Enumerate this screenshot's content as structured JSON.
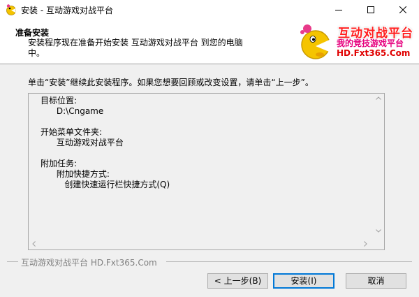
{
  "window": {
    "title": "安装 - 互动游戏对战平台",
    "controls": {
      "minimize_icon": "minimize-icon",
      "maximize_icon": "maximize-icon",
      "close_icon": "close-icon"
    }
  },
  "header": {
    "title": "准备安装",
    "description": "安装程序现在准备开始安装 互动游戏对战平台 到您的电脑中。",
    "logo": {
      "line1": "互动对战平台",
      "line2": "我的竞技游戏平台",
      "line3": "HD.Fxt365.Com"
    }
  },
  "main": {
    "instruction": "单击“安装”继续此安装程序。如果您想要回顾或改变设置，请单击“上一步”。",
    "summary": "目标位置:\n      D:\\Cngame\n\n开始菜单文件夹:\n      互动游戏对战平台\n\n附加任务:\n      附加快捷方式:\n         创建快速运行栏快捷方式(Q)"
  },
  "branding": {
    "text": "互动游戏对战平台  HD.Fxt365.Com"
  },
  "buttons": {
    "back": "< 上一步(B)",
    "install": "安装(I)",
    "cancel": "取消"
  },
  "colors": {
    "accent": "#0078d7",
    "logo_red": "#ff1e1e",
    "logo_pink": "#e6007e",
    "mascot_yellow": "#f5c400"
  }
}
